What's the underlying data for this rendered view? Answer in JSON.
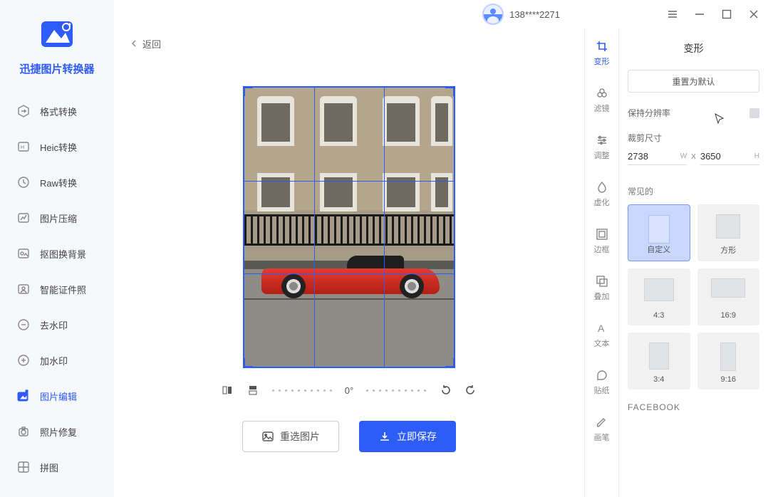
{
  "app": {
    "name": "迅捷图片转换器"
  },
  "user": {
    "phone": "138****2271"
  },
  "nav": {
    "items": [
      {
        "label": "格式转换"
      },
      {
        "label": "Heic转换"
      },
      {
        "label": "Raw转换"
      },
      {
        "label": "图片压缩"
      },
      {
        "label": "抠图换背景"
      },
      {
        "label": "智能证件照"
      },
      {
        "label": "去水印"
      },
      {
        "label": "加水印"
      },
      {
        "label": "图片编辑"
      },
      {
        "label": "照片修复"
      },
      {
        "label": "拼图"
      }
    ]
  },
  "back": {
    "label": "返回"
  },
  "rotation": {
    "value": "0°"
  },
  "actions": {
    "reselect": "重选图片",
    "save": "立即保存"
  },
  "tools": {
    "items": [
      {
        "label": "变形"
      },
      {
        "label": "滤镜"
      },
      {
        "label": "调整"
      },
      {
        "label": "虚化"
      },
      {
        "label": "边框"
      },
      {
        "label": "叠加"
      },
      {
        "label": "文本"
      },
      {
        "label": "贴纸"
      },
      {
        "label": "画笔"
      }
    ]
  },
  "panel": {
    "title": "变形",
    "reset": "重置为默认",
    "keep_res": "保持分辨率",
    "crop_label": "裁剪尺寸",
    "width": "2738",
    "height": "3650",
    "w_suffix": "W",
    "h_suffix": "H",
    "x": "X",
    "common_label": "常见的",
    "presets": [
      {
        "label": "自定义"
      },
      {
        "label": "方形"
      },
      {
        "label": "4:3"
      },
      {
        "label": "16:9"
      },
      {
        "label": "3:4"
      },
      {
        "label": "9:16"
      }
    ],
    "facebook": "FACEBOOK"
  }
}
